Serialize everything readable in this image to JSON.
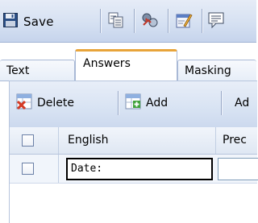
{
  "toolbar": {
    "save_label": "Save",
    "icons": [
      "save-icon",
      "copy-icon",
      "relation-icon",
      "edit-icon",
      "comment-icon"
    ]
  },
  "tabs": [
    {
      "label": "Text",
      "active": false
    },
    {
      "label": "Answers",
      "active": true
    },
    {
      "label": "Masking",
      "active": false
    }
  ],
  "answers": {
    "actions": {
      "delete_label": "Delete",
      "add_label": "Add",
      "third_label_partial": "Ad"
    },
    "columns": [
      "English",
      "Prec"
    ],
    "rows": [
      {
        "checked": false,
        "english": "Date:",
        "precode": ""
      }
    ]
  },
  "colors": {
    "toolbar_bg": "#d6e1f2",
    "active_tab_accent": "#e8a43a",
    "border": "#a9b9d6"
  }
}
